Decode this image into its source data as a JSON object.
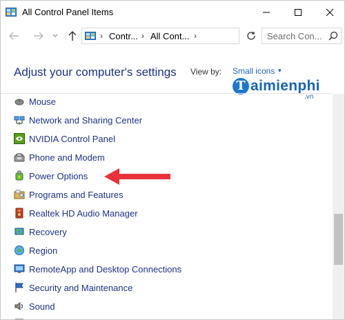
{
  "window": {
    "title": "All Control Panel Items"
  },
  "address": {
    "crumbs": [
      "Contr...",
      "All Cont..."
    ],
    "search_placeholder": "Search Con..."
  },
  "header": {
    "heading": "Adjust your computer's settings",
    "view_by_label": "View by:",
    "view_by_value": "Small icons"
  },
  "watermark": {
    "name": "aimienphi",
    "initial": "T",
    "suffix": ".vn"
  },
  "items": [
    {
      "label": "Mouse",
      "icon": "mouse-icon"
    },
    {
      "label": "Network and Sharing Center",
      "icon": "network-icon"
    },
    {
      "label": "NVIDIA Control Panel",
      "icon": "nvidia-icon"
    },
    {
      "label": "Phone and Modem",
      "icon": "phone-icon"
    },
    {
      "label": "Power Options",
      "icon": "power-icon"
    },
    {
      "label": "Programs and Features",
      "icon": "programs-icon"
    },
    {
      "label": "Realtek HD Audio Manager",
      "icon": "speaker-icon"
    },
    {
      "label": "Recovery",
      "icon": "recovery-icon"
    },
    {
      "label": "Region",
      "icon": "globe-icon"
    },
    {
      "label": "RemoteApp and Desktop Connections",
      "icon": "remote-desktop-icon"
    },
    {
      "label": "Security and Maintenance",
      "icon": "flag-icon"
    },
    {
      "label": "Sound",
      "icon": "sound-icon"
    }
  ],
  "colors": {
    "link": "#1e3287",
    "accent": "#1e64c8",
    "annotation": "#e8333a"
  }
}
